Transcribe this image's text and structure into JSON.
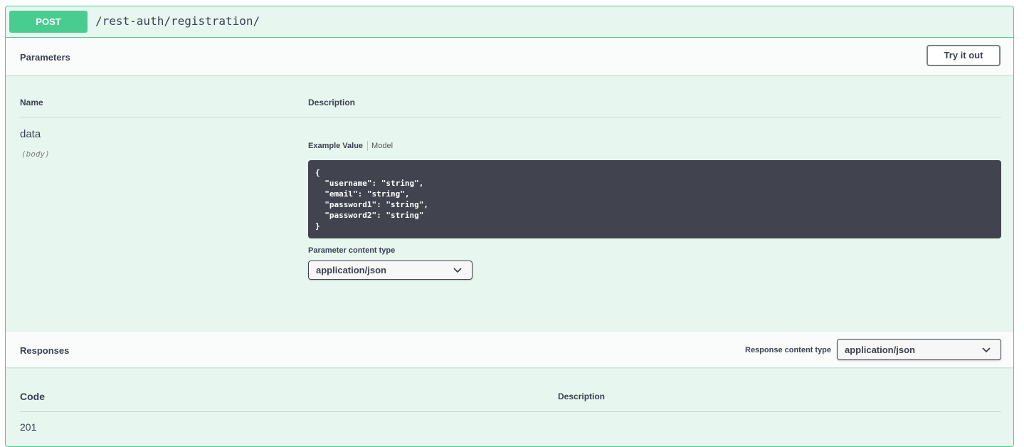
{
  "operation": {
    "method": "POST",
    "path": "/rest-auth/registration/"
  },
  "parameters": {
    "title": "Parameters",
    "try_label": "Try it out",
    "col_name": "Name",
    "col_description": "Description",
    "items": [
      {
        "name": "data",
        "in": "(body)",
        "tabs": {
          "example": "Example Value",
          "model": "Model"
        },
        "example": "{\n  \"username\": \"string\",\n  \"email\": \"string\",\n  \"password1\": \"string\",\n  \"password2\": \"string\"\n}",
        "content_type_label": "Parameter content type",
        "content_type_value": "application/json"
      }
    ]
  },
  "responses": {
    "title": "Responses",
    "content_type_label": "Response content type",
    "content_type_value": "application/json",
    "col_code": "Code",
    "col_description": "Description",
    "rows": [
      {
        "code": "201"
      }
    ]
  },
  "colors": {
    "post": "#49cc90",
    "background": "#e8f6f0",
    "code_bg": "#41444e"
  },
  "icons": {
    "select_arrow": "chevron-down-icon"
  }
}
